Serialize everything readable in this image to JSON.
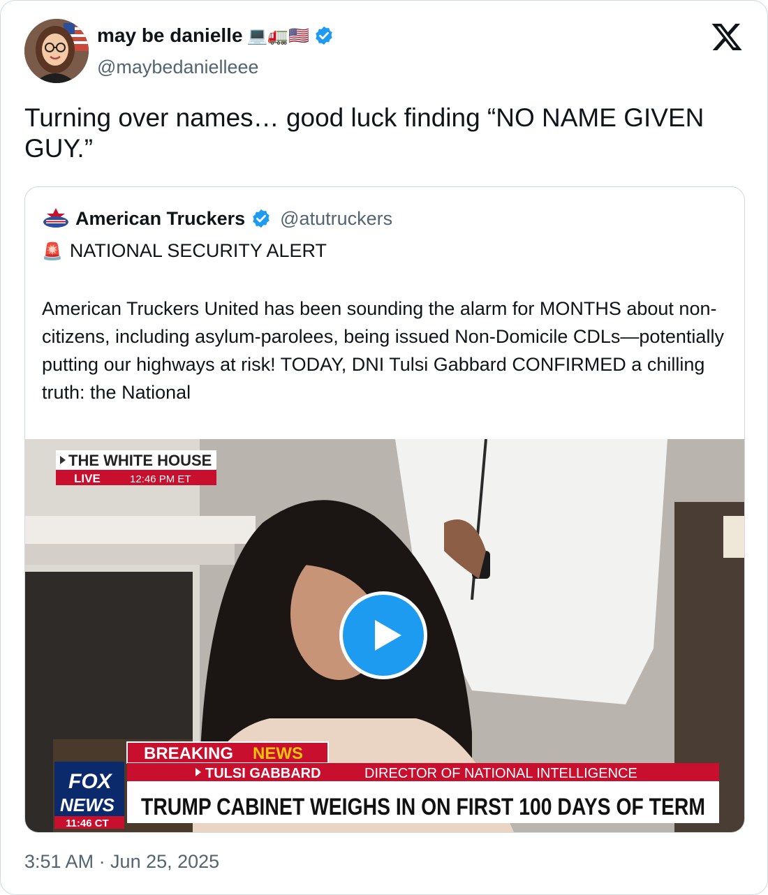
{
  "author": {
    "name": "may be danielle",
    "name_emojis": "💻🚛🇺🇸",
    "handle": "@maybedanielleee"
  },
  "tweet": {
    "text": "Turning over names… good luck finding “NO NAME GIVEN GUY.”",
    "timestamp": "3:51 AM · Jun 25, 2025"
  },
  "quoted": {
    "name": "American Truckers",
    "handle": "@atutruckers",
    "alert_icon": "🚨",
    "alert_text": "NATIONAL SECURITY ALERT",
    "body": "American Truckers United has been sounding the alarm for MONTHS about non-citizens, including asylum-parolees, being issued Non-Domicile CDLs—potentially putting our highways at risk! TODAY, DNI Tulsi Gabbard CONFIRMED a chilling truth: the National"
  },
  "video": {
    "bug_location": "THE WHITE HOUSE",
    "bug_live": "LIVE",
    "bug_time": "12:46 PM ET",
    "breaking": "BREAKING",
    "news": "NEWS",
    "lower_name": "TULSI GABBARD",
    "lower_title": "DIRECTOR OF NATIONAL INTELLIGENCE",
    "headline": "TRUMP CABINET WEIGHS IN ON FIRST 100 DAYS OF TERM",
    "logo_fox": "FOX",
    "logo_news": "NEWS",
    "logo_time": "11:46 CT"
  },
  "colors": {
    "verified": "#1d9bf0",
    "text": "#0f1419",
    "muted": "#536471",
    "border": "#cfd9de",
    "chyron_red": "#c8102e",
    "breaking_yellow": "#f6c40a"
  }
}
